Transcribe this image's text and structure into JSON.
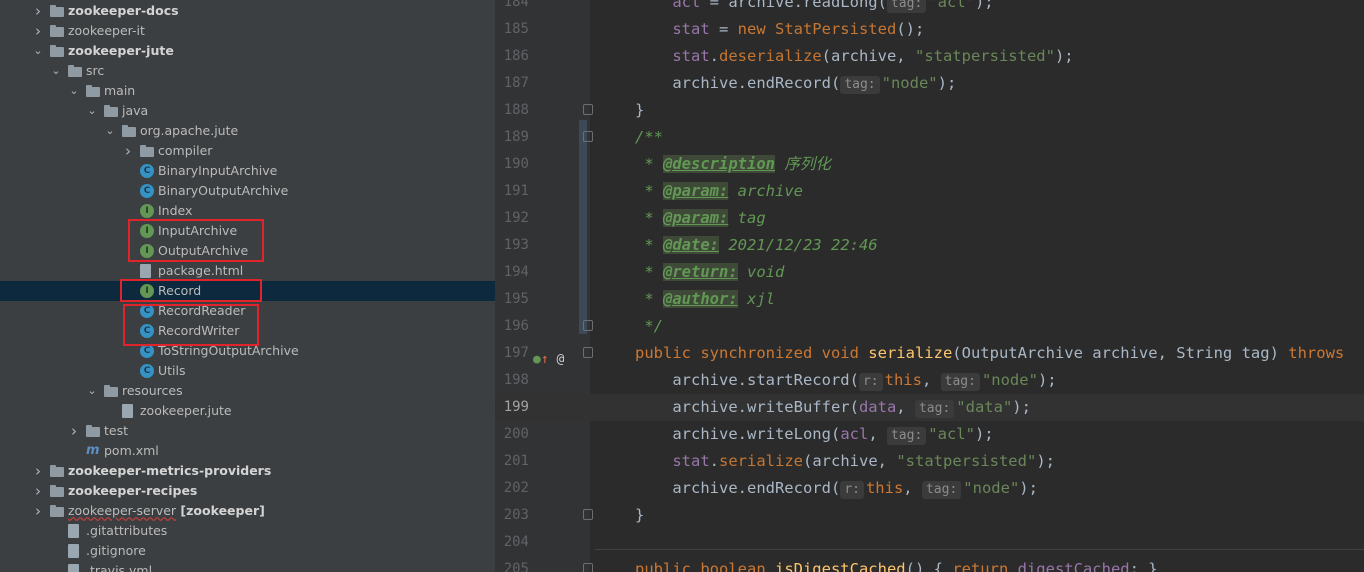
{
  "tree": {
    "items": [
      {
        "label": "zookeeper-docs",
        "depth": 0,
        "arrow": "right",
        "icon": "module-folder-icon",
        "bold": true
      },
      {
        "label": "zookeeper-it",
        "depth": 0,
        "arrow": "right",
        "icon": "folder-icon",
        "bold": false
      },
      {
        "label": "zookeeper-jute",
        "depth": 0,
        "arrow": "down",
        "icon": "module-folder-icon",
        "bold": true
      },
      {
        "label": "src",
        "depth": 1,
        "arrow": "down",
        "icon": "folder-icon"
      },
      {
        "label": "main",
        "depth": 2,
        "arrow": "down",
        "icon": "folder-icon"
      },
      {
        "label": "java",
        "depth": 3,
        "arrow": "down",
        "icon": "source-folder-icon"
      },
      {
        "label": "org.apache.jute",
        "depth": 4,
        "arrow": "down",
        "icon": "package-icon"
      },
      {
        "label": "compiler",
        "depth": 5,
        "arrow": "right",
        "icon": "package-icon"
      },
      {
        "label": "BinaryInputArchive",
        "depth": 5,
        "icon": "class-icon",
        "glyph": "C"
      },
      {
        "label": "BinaryOutputArchive",
        "depth": 5,
        "icon": "class-icon",
        "glyph": "C"
      },
      {
        "label": "Index",
        "depth": 5,
        "icon": "interface-icon",
        "glyph": "I"
      },
      {
        "label": "InputArchive",
        "depth": 5,
        "icon": "interface-icon",
        "glyph": "I"
      },
      {
        "label": "OutputArchive",
        "depth": 5,
        "icon": "interface-icon",
        "glyph": "I"
      },
      {
        "label": "package.html",
        "depth": 5,
        "icon": "html-file-icon"
      },
      {
        "label": "Record",
        "depth": 5,
        "icon": "interface-icon",
        "glyph": "I",
        "selected": true
      },
      {
        "label": "RecordReader",
        "depth": 5,
        "icon": "class-icon",
        "glyph": "C"
      },
      {
        "label": "RecordWriter",
        "depth": 5,
        "icon": "class-icon",
        "glyph": "C"
      },
      {
        "label": "ToStringOutputArchive",
        "depth": 5,
        "icon": "class-icon",
        "glyph": "C"
      },
      {
        "label": "Utils",
        "depth": 5,
        "icon": "class-icon",
        "glyph": "C"
      },
      {
        "label": "resources",
        "depth": 3,
        "arrow": "down",
        "icon": "folder-icon"
      },
      {
        "label": "zookeeper.jute",
        "depth": 4,
        "icon": "file-icon"
      },
      {
        "label": "test",
        "depth": 2,
        "arrow": "right",
        "icon": "folder-icon"
      },
      {
        "label": "pom.xml",
        "depth": 2,
        "icon": "maven-icon"
      },
      {
        "label": "zookeeper-metrics-providers",
        "depth": 0,
        "arrow": "right",
        "icon": "module-folder-icon",
        "bold": true
      },
      {
        "label": "zookeeper-recipes",
        "depth": 0,
        "arrow": "right",
        "icon": "module-folder-icon",
        "bold": true
      },
      {
        "label": "zookeeper-server",
        "suffix": "[zookeeper]",
        "depth": 0,
        "arrow": "right",
        "icon": "module-folder-icon",
        "wavy": true
      },
      {
        "label": ".gitattributes",
        "depth": 1,
        "icon": "file-icon"
      },
      {
        "label": ".gitignore",
        "depth": 1,
        "icon": "file-icon"
      },
      {
        "label": ".travis.yml",
        "depth": 1,
        "icon": "file-icon"
      }
    ]
  },
  "editor": {
    "current_line": 199,
    "lines": [
      {
        "n": 184,
        "html": "    <span class=\"fld\">acl</span> = archive.readLong(<span class=\"hint\">tag:</span><span class=\"str\">\"acl\"</span>);"
      },
      {
        "n": 185,
        "html": "    <span class=\"fld\">stat</span> = <span class=\"kw\">new </span><span class=\"mth\">StatPersisted</span>();"
      },
      {
        "n": 186,
        "html": "    <span class=\"fld\">stat</span>.<span class=\"mth\">deserialize</span>(archive, <span class=\"str\">\"statpersisted\"</span>);"
      },
      {
        "n": 187,
        "html": "    archive.endRecord(<span class=\"hint\">tag:</span><span class=\"str\">\"node\"</span>);"
      },
      {
        "n": 188,
        "html": "}"
      },
      {
        "n": 189,
        "html": "<span class=\"cmt\">/**</span>"
      },
      {
        "n": 190,
        "html": "<span class=\"cmt\"> * <span class=\"tag\">@description</span> 序列化</span>"
      },
      {
        "n": 191,
        "html": "<span class=\"cmt\"> * <span class=\"tag\">@param:</span> archive</span>"
      },
      {
        "n": 192,
        "html": "<span class=\"cmt\"> * <span class=\"tag\">@param:</span> tag</span>"
      },
      {
        "n": 193,
        "html": "<span class=\"cmt\"> * <span class=\"tag\">@date:</span> 2021/12/23 22:46</span>"
      },
      {
        "n": 194,
        "html": "<span class=\"cmt\"> * <span class=\"tag\">@return:</span> void</span>"
      },
      {
        "n": 195,
        "html": "<span class=\"cmt\"> * <span class=\"tag\">@author:</span> xjl</span>"
      },
      {
        "n": 196,
        "html": "<span class=\"cmt\"> */</span>"
      },
      {
        "n": 197,
        "html": "<span class=\"kw\">public synchronized void </span><span class=\"fn\">serialize</span>(OutputArchive archive, String tag) <span class=\"kw\">throws</span>"
      },
      {
        "n": 198,
        "html": "    archive.startRecord(<span class=\"hint\">r:</span><span class=\"kw\">this</span>, <span class=\"hint\">tag:</span><span class=\"str\">\"node\"</span>);"
      },
      {
        "n": 199,
        "html": "    archive.writeBuffer(<span class=\"fld\">data</span>, <span class=\"hint\">tag:</span><span class=\"str\">\"data\"</span>);"
      },
      {
        "n": 200,
        "html": "    archive.writeLong(<span class=\"fld\">acl</span>, <span class=\"hint\">tag:</span><span class=\"str\">\"acl\"</span>);"
      },
      {
        "n": 201,
        "html": "    <span class=\"fld\">stat</span>.<span class=\"mth\">serialize</span>(archive, <span class=\"str\">\"statpersisted\"</span>);"
      },
      {
        "n": 202,
        "html": "    archive.endRecord(<span class=\"hint\">r:</span><span class=\"kw\">this</span>, <span class=\"hint\">tag:</span><span class=\"str\">\"node\"</span>);"
      },
      {
        "n": 203,
        "html": "}"
      },
      {
        "n": 204,
        "html": ""
      },
      {
        "n": 205,
        "html": "<span class=\"kw\">public boolean </span><span class=\"fn\">isDigestCached</span>() { <span class=\"kw\">return </span><span class=\"fld\">digestCached</span>; }"
      }
    ]
  }
}
